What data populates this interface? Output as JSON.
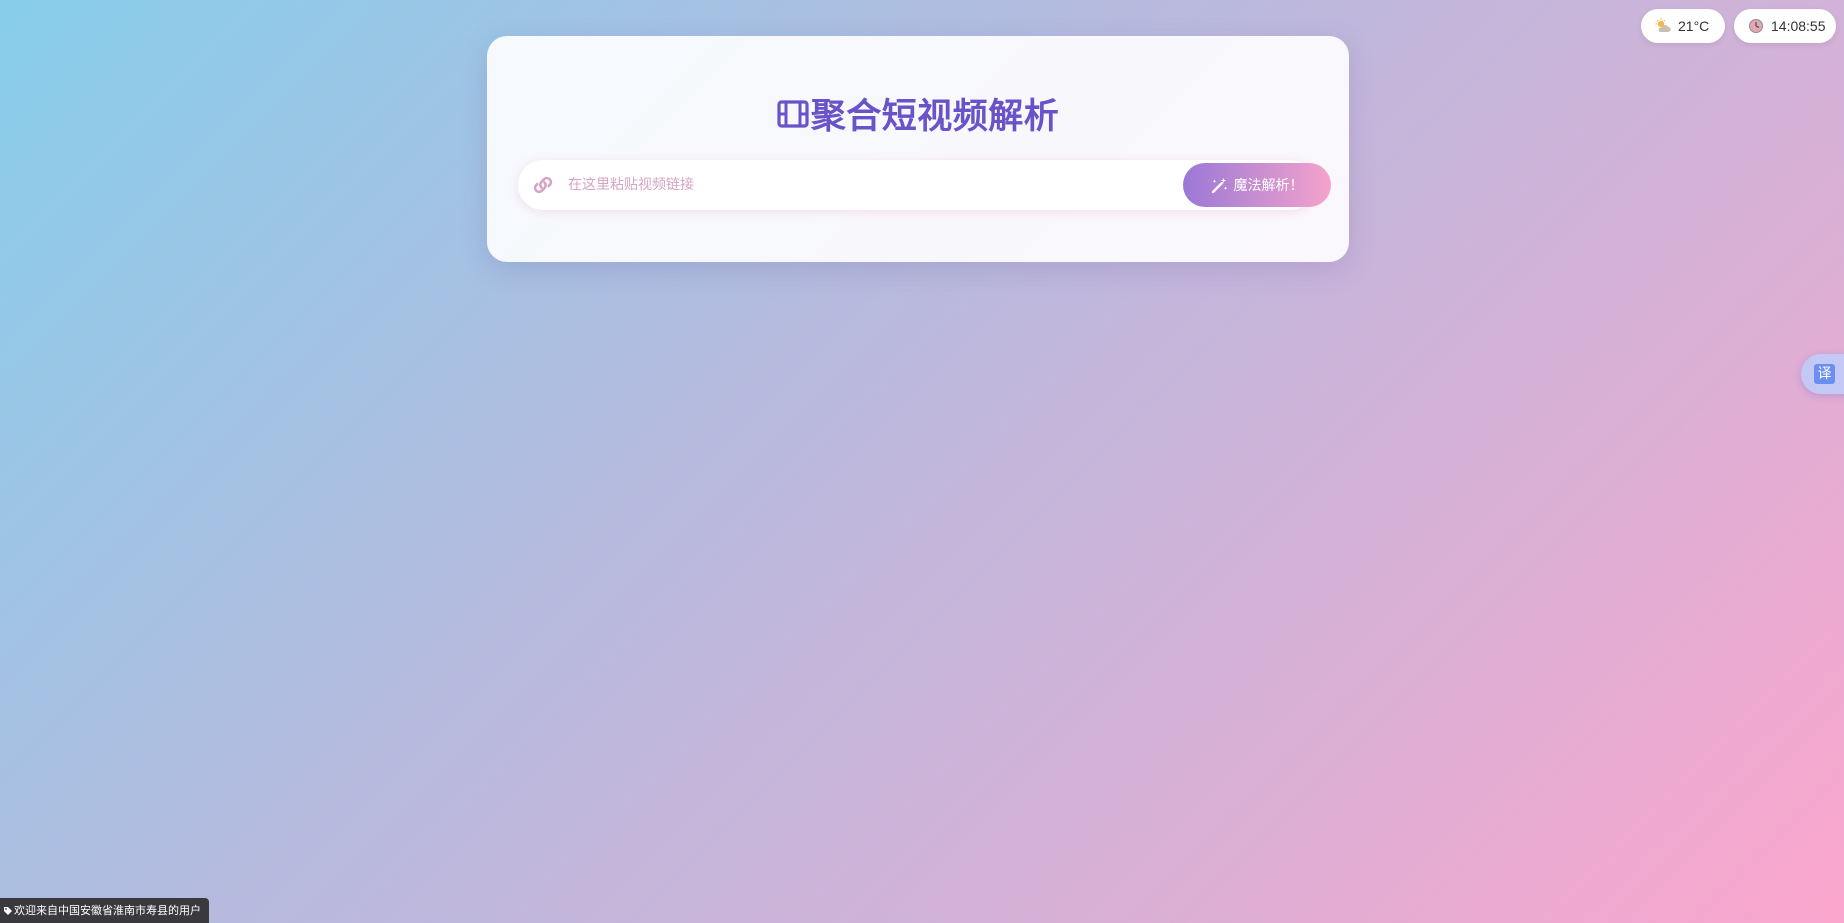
{
  "weather": {
    "icon": "cloud-sun-icon",
    "temperature": "21°C"
  },
  "clock": {
    "icon": "clock-icon",
    "time": "14:08:55"
  },
  "card": {
    "title_icon": "film-icon",
    "title": "聚合短视频解析",
    "search": {
      "icon": "link-icon",
      "placeholder": "在这里粘贴视频链接",
      "value": ""
    },
    "button": {
      "icon": "magic-wand-icon",
      "label": "魔法解析！"
    }
  },
  "translate": {
    "icon": "translate-icon",
    "label": "译"
  },
  "welcome": {
    "icon": "tag-icon",
    "text": "欢迎来自中国安徽省淮南市寿县的用户"
  },
  "colors": {
    "accent": "#6a52c9",
    "button_start": "#9a78d7",
    "button_end": "#f5a3cb",
    "background_start": "#87ceeb",
    "background_end": "#fba5cc"
  }
}
